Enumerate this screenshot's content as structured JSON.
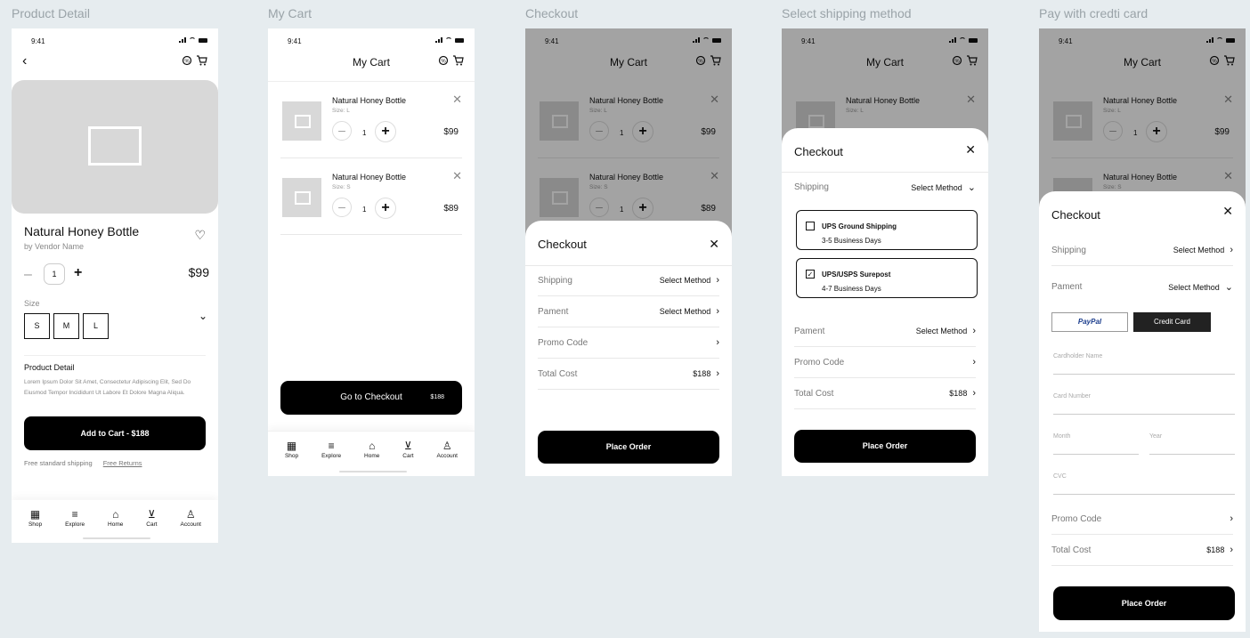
{
  "frames": [
    "Product Detail",
    "My Cart",
    "Checkout",
    "Select shipping method",
    "Pay with credti card"
  ],
  "status": {
    "time": "9:41"
  },
  "product": {
    "name": "Natural Honey Bottle",
    "vendor": "by Vendor Name",
    "qty": "1",
    "price": "$99",
    "size_label": "Size",
    "sizes": [
      "S",
      "M",
      "L"
    ],
    "detail_title": "Product Detail",
    "detail_text": "Lorem Ipsum Dolor Sit Amet, Consectetur Adipiscing Elit, Sed Do Eiusmod Tempor Incididunt Ut Labore Et Dolore Magna Aliqua.",
    "add_button": "Add to Cart - $188",
    "shipping_note": "Free standard shipping",
    "returns_link": "Free Returns"
  },
  "tabs": [
    "Shop",
    "Explore",
    "Home",
    "Cart",
    "Account"
  ],
  "cart": {
    "title": "My Cart",
    "items": [
      {
        "name": "Natural Honey Bottle",
        "size": "Size: L",
        "qty": "1",
        "price": "$99"
      },
      {
        "name": "Natural Honey Bottle",
        "size": "Size: S",
        "qty": "1",
        "price": "$89"
      }
    ],
    "checkout_button": "Go to Checkout",
    "checkout_total": "$188"
  },
  "checkout": {
    "title": "Checkout",
    "shipping": "Shipping",
    "payment": "Pament",
    "promo": "Promo Code",
    "total_label": "Total Cost",
    "total": "$188",
    "select_method": "Select Method",
    "place_order": "Place Order"
  },
  "shipping_options": [
    {
      "name": "UPS Ground Shipping",
      "days": "3-5 Business Days",
      "checked": false
    },
    {
      "name": "UPS/USPS Surepost",
      "days": "4-7 Business Days",
      "checked": true
    }
  ],
  "card": {
    "paypal": "PayPal",
    "credit": "Credit Card",
    "holder": "Cardholder Name",
    "number": "Card Number",
    "month": "Month",
    "year": "Year",
    "cvc": "CVC"
  }
}
